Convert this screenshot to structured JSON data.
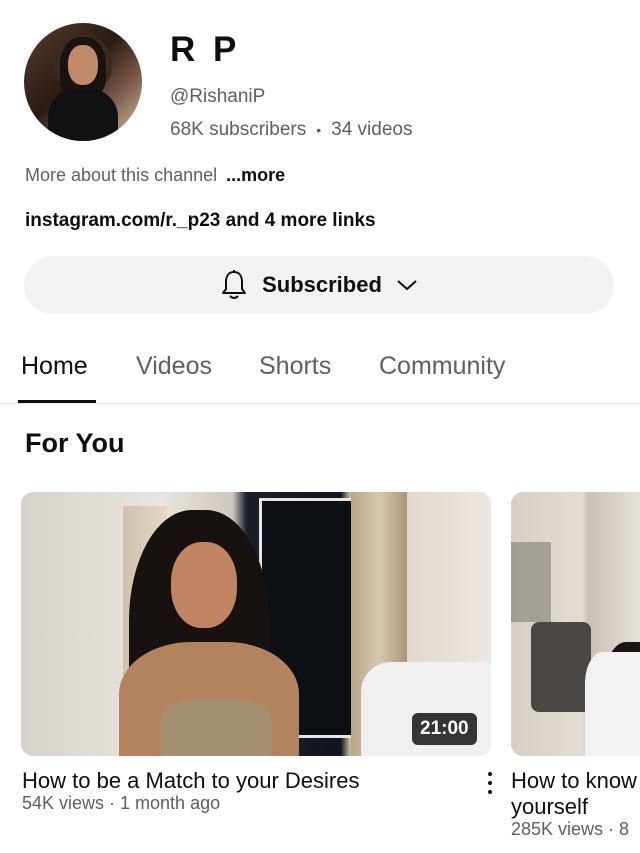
{
  "channel": {
    "name": "R P",
    "handle": "@RishaniP",
    "subscribers": "68K subscribers",
    "separator": "•",
    "videos": "34 videos",
    "about_text": "More about this channel",
    "about_more": "...more",
    "links": "instagram.com/r._p23 and 4 more links"
  },
  "subscribe": {
    "label": "Subscribed",
    "icon": "bell-icon",
    "chevron": "chevron-down-icon"
  },
  "tabs": [
    {
      "label": "Home",
      "active": true
    },
    {
      "label": "Videos",
      "active": false
    },
    {
      "label": "Shorts",
      "active": false
    },
    {
      "label": "Community",
      "active": false
    }
  ],
  "section": {
    "title": "For You"
  },
  "videos": [
    {
      "title": "How to be a Match to your Desires",
      "meta": "54K views · 1 month ago",
      "duration": "21:00"
    },
    {
      "title": "How to know yourself",
      "meta": "285K views · 8"
    }
  ],
  "colors": {
    "text_primary": "#0f0f0f",
    "text_secondary": "#606060",
    "button_bg": "#f2f2f2"
  }
}
